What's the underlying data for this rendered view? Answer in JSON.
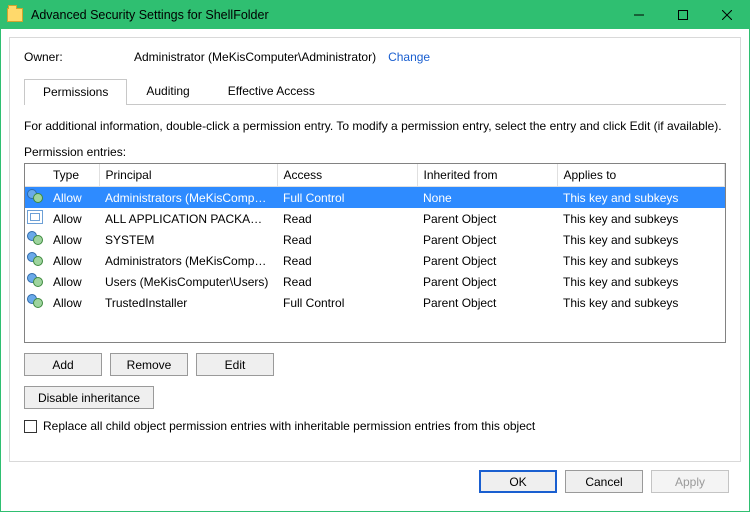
{
  "window": {
    "title": "Advanced Security Settings for ShellFolder",
    "icon": "folder-icon"
  },
  "owner": {
    "label": "Owner:",
    "value": "Administrator (MeKisComputer\\Administrator)",
    "change_link": "Change"
  },
  "tabs": [
    {
      "label": "Permissions",
      "active": true
    },
    {
      "label": "Auditing",
      "active": false
    },
    {
      "label": "Effective Access",
      "active": false
    }
  ],
  "info_text": "For additional information, double-click a permission entry. To modify a permission entry, select the entry and click Edit (if available).",
  "entries_label": "Permission entries:",
  "columns": {
    "type": "Type",
    "principal": "Principal",
    "access": "Access",
    "inherited": "Inherited from",
    "applies": "Applies to"
  },
  "rows": [
    {
      "icon": "users",
      "type": "Allow",
      "principal": "Administrators (MeKisCompu…",
      "access": "Full Control",
      "inherited": "None",
      "applies": "This key and subkeys",
      "selected": true
    },
    {
      "icon": "pkg",
      "type": "Allow",
      "principal": "ALL APPLICATION PACKAGES",
      "access": "Read",
      "inherited": "Parent Object",
      "applies": "This key and subkeys"
    },
    {
      "icon": "users",
      "type": "Allow",
      "principal": "SYSTEM",
      "access": "Read",
      "inherited": "Parent Object",
      "applies": "This key and subkeys"
    },
    {
      "icon": "users",
      "type": "Allow",
      "principal": "Administrators (MeKisComput…",
      "access": "Read",
      "inherited": "Parent Object",
      "applies": "This key and subkeys"
    },
    {
      "icon": "users",
      "type": "Allow",
      "principal": "Users (MeKisComputer\\Users)",
      "access": "Read",
      "inherited": "Parent Object",
      "applies": "This key and subkeys"
    },
    {
      "icon": "users",
      "type": "Allow",
      "principal": "TrustedInstaller",
      "access": "Full Control",
      "inherited": "Parent Object",
      "applies": "This key and subkeys"
    }
  ],
  "buttons": {
    "add": "Add",
    "remove": "Remove",
    "edit": "Edit",
    "disable_inheritance": "Disable inheritance"
  },
  "replace_checkbox": {
    "checked": false,
    "label": "Replace all child object permission entries with inheritable permission entries from this object"
  },
  "footer": {
    "ok": "OK",
    "cancel": "Cancel",
    "apply": "Apply"
  }
}
